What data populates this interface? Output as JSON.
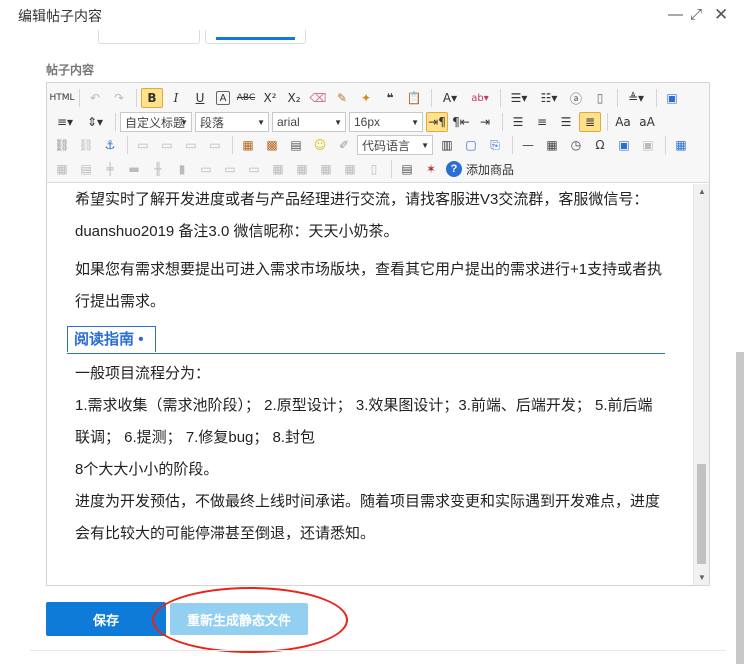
{
  "window": {
    "title": "编辑帖子内容",
    "controls": [
      "minimize-icon",
      "maximize-icon",
      "close-icon"
    ]
  },
  "field": {
    "label": "帖子内容"
  },
  "toolbar": {
    "row1": [
      "HTML",
      "↶",
      "↷",
      "B",
      "I",
      "U",
      "A",
      "ABC",
      "X²",
      "X₂",
      "eraser",
      "brush",
      "magic",
      "❝",
      "paste",
      "A",
      "ab",
      "ol",
      "ul",
      "a",
      "doc",
      "line-height",
      "preview"
    ],
    "row2_combos": {
      "custom_title": "自定义标题",
      "paragraph": "段落",
      "font": "arial",
      "size": "16px"
    },
    "row3_combos": {
      "code_lang": "代码语言"
    },
    "add_product": "添加商品",
    "active_color": "#ffe28a"
  },
  "content": {
    "para1": "希望实时了解开发进度或者与产品经理进行交流，请找客服进V3交流群，客服微信号：duanshuo2019  备注3.0 微信昵称：天天小奶茶。",
    "para2": "如果您有需求想要提出可进入需求市场版块，查看其它用户提出的需求进行+1支持或者执行提出需求。",
    "guide_title": "阅读指南",
    "guide_bullet": "•",
    "line1": "一般项目流程分为：",
    "line2": "1.需求收集（需求池阶段）； 2.原型设计； 3.效果图设计；3.前端、后端开发；  5.前后端联调； 6.提测； 7.修复bug； 8.封包",
    "line3": "8个大大小小的阶段。",
    "line4": "进度为开发预估，不做最终上线时间承诺。随着项目需求变更和实际遇到开发难点，进度会有比较大的可能停滞甚至倒退，还请悉知。"
  },
  "buttons": {
    "save": "保存",
    "regenerate": "重新生成静态文件"
  },
  "colors": {
    "primary": "#0f7bd8",
    "regen_bg": "#93cff0",
    "highlight_circle": "#e8251c",
    "guide_accent": "#2a6ed3"
  }
}
